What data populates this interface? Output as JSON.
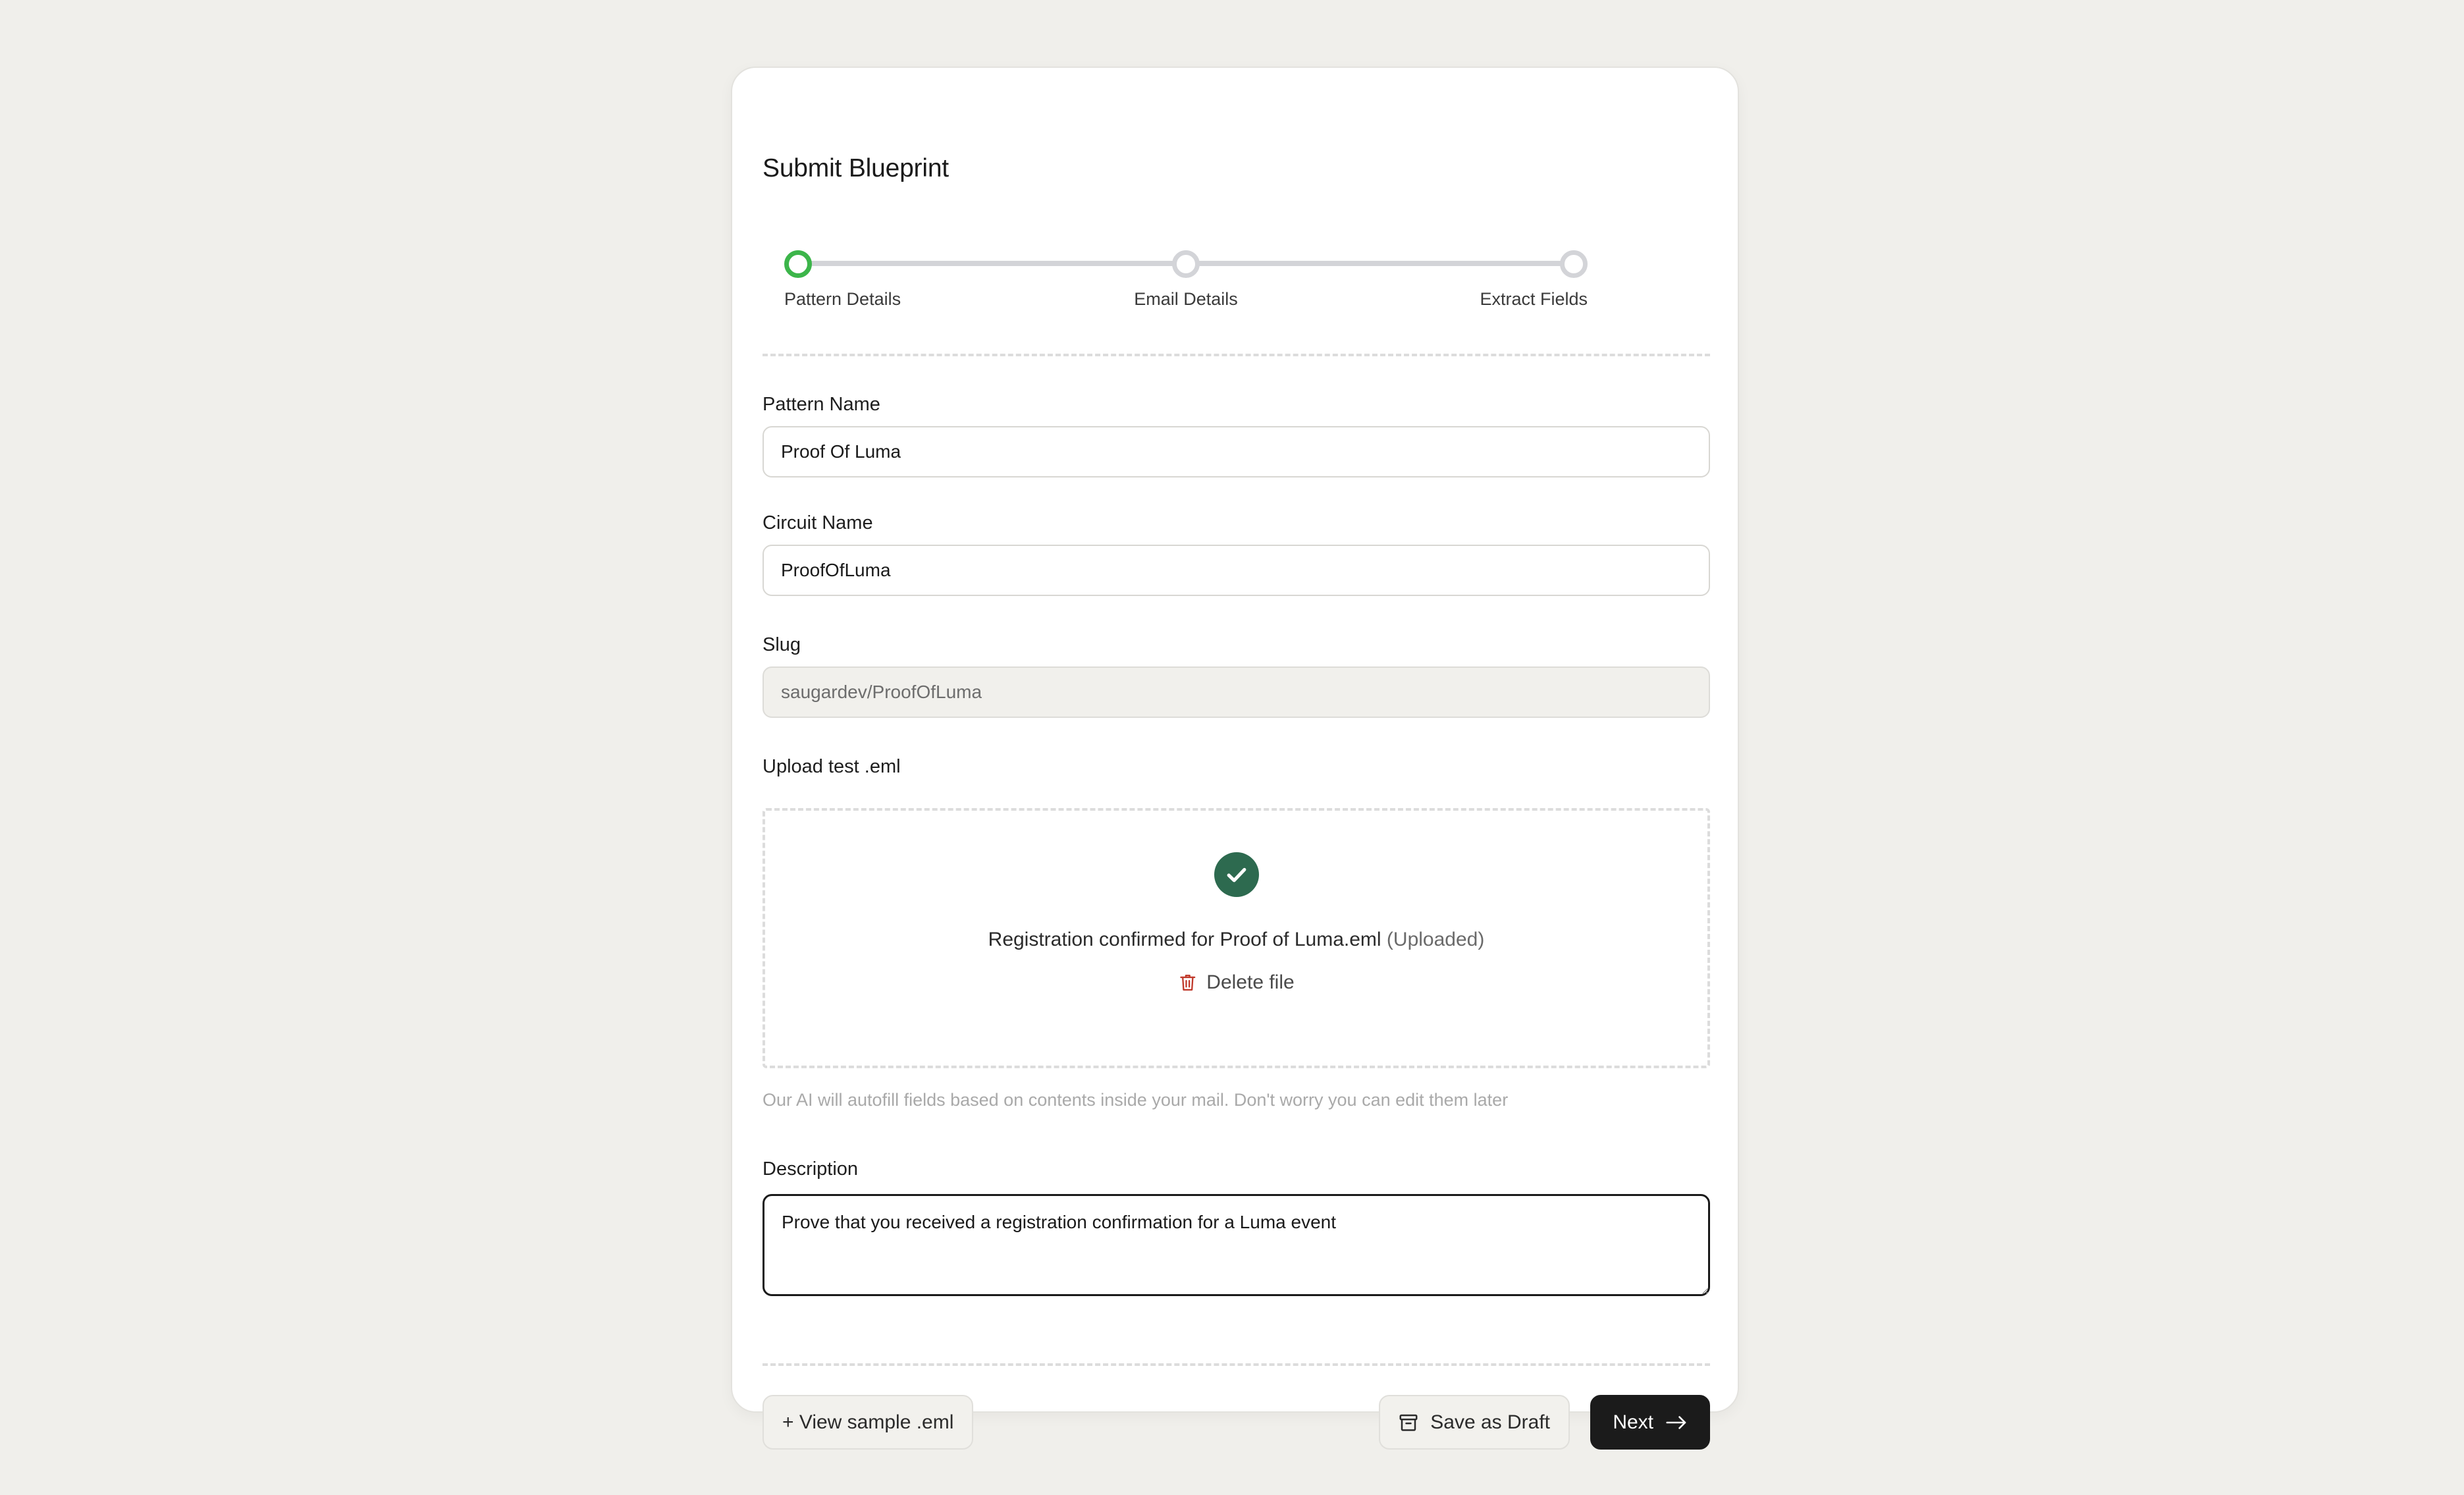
{
  "card": {
    "title": "Submit Blueprint"
  },
  "stepper": {
    "steps": [
      {
        "label": "Pattern Details",
        "state": "active"
      },
      {
        "label": "Email Details",
        "state": "inactive"
      },
      {
        "label": "Extract Fields",
        "state": "inactive"
      }
    ],
    "active_color": "#3cb54a",
    "inactive_color": "#d3d4d8"
  },
  "fields": {
    "pattern_name": {
      "label": "Pattern Name",
      "value": "Proof Of Luma",
      "placeholder": ""
    },
    "circuit_name": {
      "label": "Circuit Name",
      "value": "ProofOfLuma",
      "placeholder": ""
    },
    "slug": {
      "label": "Slug",
      "value": "saugardev/ProofOfLuma",
      "placeholder": "",
      "readonly": true
    },
    "description": {
      "label": "Description",
      "value": "Prove that you received a registration confirmation for a Luma event",
      "placeholder": ""
    }
  },
  "upload": {
    "label": "Upload test .eml",
    "status_icon": "check-circle-icon",
    "status_color": "#2d6a4f",
    "filename": "Registration confirmed for Proof of Luma.eml",
    "uploaded_tag": " (Uploaded)",
    "delete_icon": "trash-icon",
    "delete_label": "Delete file",
    "delete_icon_color": "#c0392b",
    "helper_text": "Our AI will autofill fields based on contents inside your mail. Don't worry you can edit them later"
  },
  "footer": {
    "view_sample_label": "+ View sample .eml",
    "save_draft_label": "Save as Draft",
    "save_draft_icon": "archive-icon",
    "next_label": "Next",
    "next_icon": "arrow-right-icon",
    "next_bg": "#1b1b1b"
  }
}
